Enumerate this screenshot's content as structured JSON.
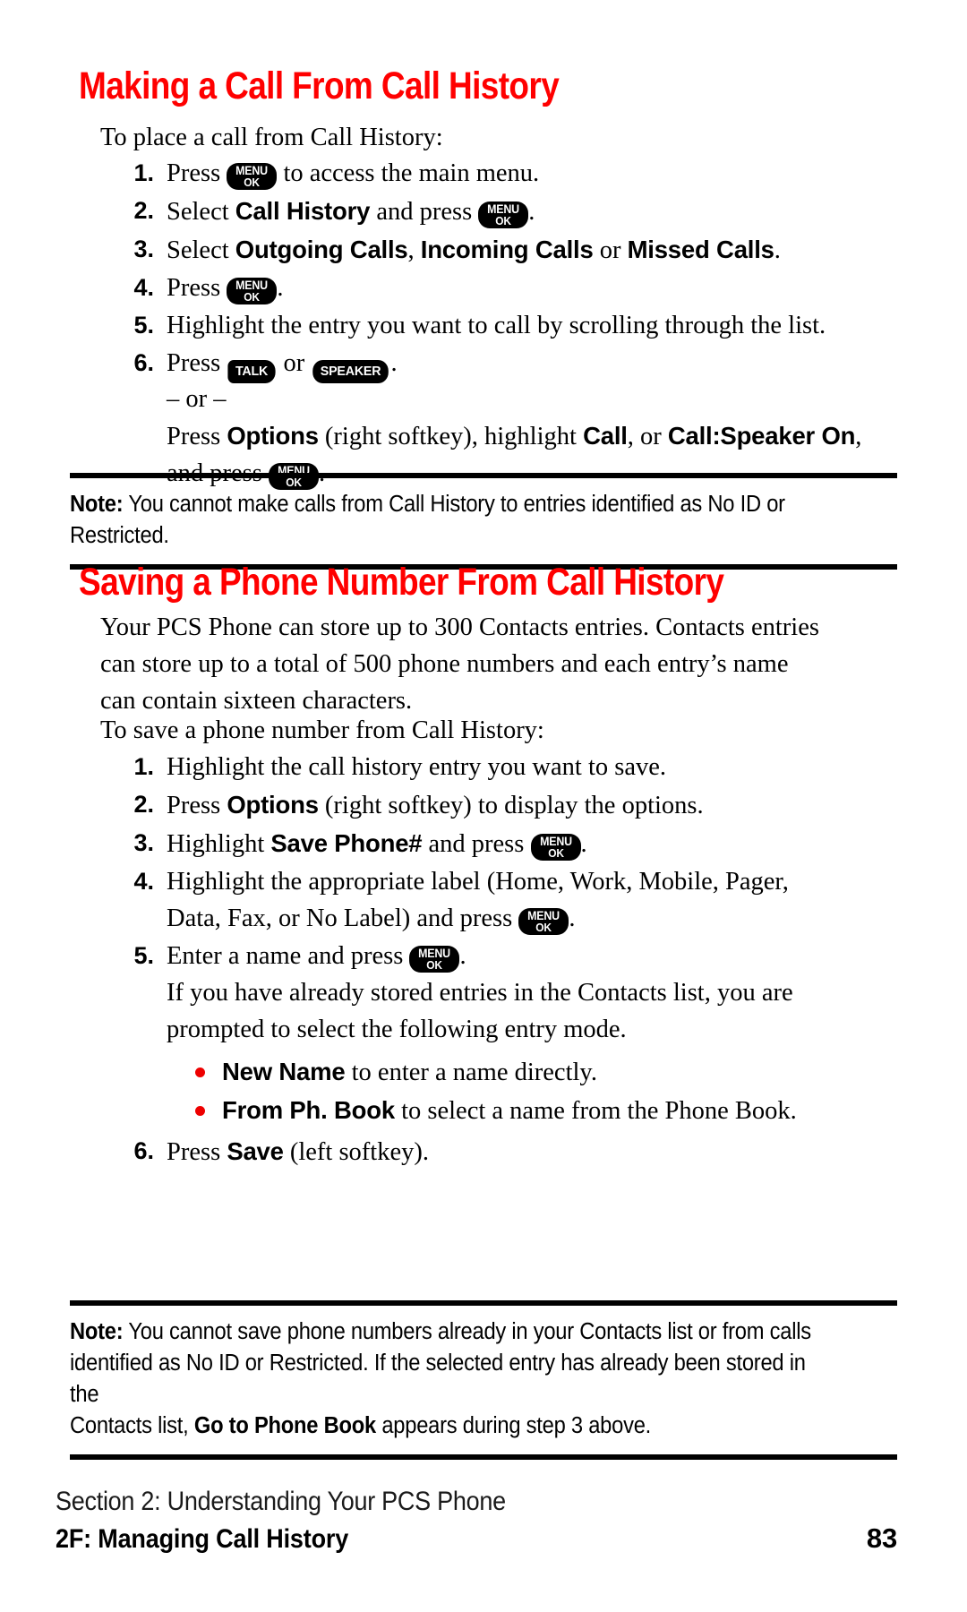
{
  "page": {
    "number": "83",
    "background": "#ffffff",
    "accent_color": "#ff0000",
    "text_color": "#000000"
  },
  "keys": {
    "menu_line1": "MENU",
    "menu_line2": "OK",
    "talk": "TALK",
    "speaker": "SPEAKER"
  },
  "section1": {
    "heading": "Making a Call From Call History",
    "lead": "To place a call from Call History:",
    "steps": [
      {
        "num": "1.",
        "before": "Press ",
        "key": "menu-ok",
        "after": " to access the main menu."
      },
      {
        "num": "2.",
        "before": "Select ",
        "bold": "Call History",
        "mid": " and press ",
        "key": "menu-ok",
        "after": "."
      },
      {
        "num": "3.",
        "before": "Select ",
        "bold1": "Outgoing Calls",
        "sep1": ", ",
        "bold2": "Incoming Calls",
        "sep2": " or ",
        "bold3": "Missed Calls",
        "after": "."
      },
      {
        "num": "4.",
        "before": "Press ",
        "key": "menu-ok",
        "after": "."
      },
      {
        "num": "5.",
        "text": "Highlight the entry you want to call by scrolling through the list."
      },
      {
        "num": "6.",
        "before": "Press ",
        "key1": "talk",
        "mid": " or ",
        "key2": "speaker",
        "after": ".",
        "or_divider": "– or –",
        "alt_line1_a": "Press ",
        "alt_bold1": "Options",
        "alt_line1_b": " (right softkey), highlight ",
        "alt_bold2": "Call",
        "alt_line1_c": ", or ",
        "alt_bold3": "Call:Speaker On",
        "alt_line1_d": ",",
        "alt_line2_a": "and press ",
        "alt_line2_b": "."
      }
    ],
    "note": {
      "label": "Note:",
      "text": " You cannot make calls from Call History to entries identified as No ID or Restricted."
    }
  },
  "section2": {
    "heading": "Saving a Phone Number From Call History",
    "paragraph_lines": [
      "Your PCS Phone can store up to 300 Contacts entries. Contacts entries",
      "can store up to a total of 500 phone numbers and each entry’s name",
      "can contain sixteen characters."
    ],
    "lead": "To save a phone number from Call History:",
    "steps": [
      {
        "num": "1.",
        "text": "Highlight the call history entry you want to save."
      },
      {
        "num": "2.",
        "before": "Press ",
        "bold": "Options",
        "after": " (right softkey) to display the options."
      },
      {
        "num": "3.",
        "before": "Highlight ",
        "bold": "Save Phone#",
        "mid": " and press ",
        "key": "menu-ok",
        "after": "."
      },
      {
        "num": "4.",
        "line1": "Highlight the appropriate label (Home, Work, Mobile, Pager,",
        "line2_a": "Data, Fax, or No Label) and press ",
        "key": "menu-ok",
        "line2_b": "."
      },
      {
        "num": "5.",
        "before": "Enter a name and press ",
        "key": "menu-ok",
        "after": ".",
        "sub_line1": "If you have already stored entries in the Contacts list, you are",
        "sub_line2": "prompted to select the following entry mode.",
        "bullets": [
          {
            "bold": "New Name",
            "rest": " to enter a name directly."
          },
          {
            "bold": "From Ph. Book",
            "rest": " to select a name from the Phone Book."
          }
        ]
      },
      {
        "num": "6.",
        "before": "Press ",
        "bold": "Save",
        "after": " (left softkey)."
      }
    ],
    "note": {
      "label": "Note:",
      "line1": " You cannot save phone numbers already in your Contacts list or from calls",
      "line2": "identified as No ID or Restricted. If the selected entry has already been stored in the",
      "line3_a": "Contacts list, ",
      "line3_bold": "Go to Phone Book",
      "line3_b": " appears during step 3 above."
    }
  },
  "footer": {
    "section_label": "Section 2: Understanding Your PCS Phone",
    "chapter_label": "2F: Managing Call History",
    "page_number": "83"
  }
}
